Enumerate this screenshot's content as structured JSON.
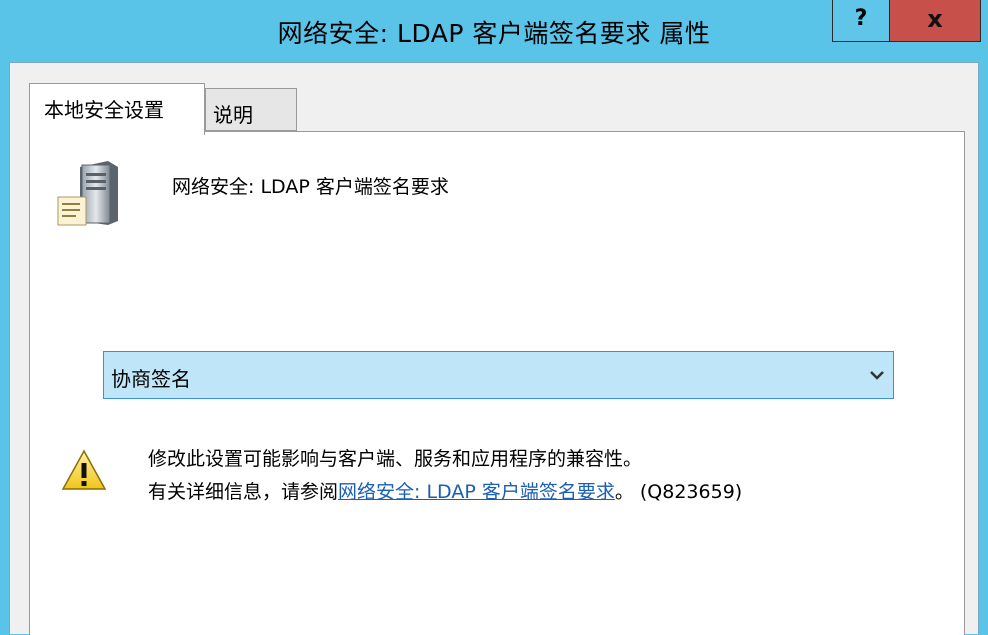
{
  "window": {
    "title": "网络安全: LDAP 客户端签名要求 属性",
    "help_button": "?",
    "close_button": "x"
  },
  "tabs": [
    {
      "label": "本地安全设置",
      "active": true
    },
    {
      "label": "说明",
      "active": false
    }
  ],
  "policy": {
    "icon": "server-document-icon",
    "name": "网络安全: LDAP 客户端签名要求"
  },
  "setting": {
    "selected_value": "协商签名",
    "arrow_icon": "chevron-down-icon"
  },
  "warning": {
    "icon": "warning-triangle-icon",
    "line1": "修改此设置可能影响与客户端、服务和应用程序的兼容性。",
    "line2_prefix": "有关详细信息，请参阅",
    "link_text": "网络安全: LDAP 客户端签名要求",
    "line2_suffix": "。 (Q823659)"
  },
  "colors": {
    "titlebar": "#59c3e8",
    "close_button": "#c7504a",
    "combo_fill": "#bfe6f8",
    "link": "#1a5fb4"
  }
}
